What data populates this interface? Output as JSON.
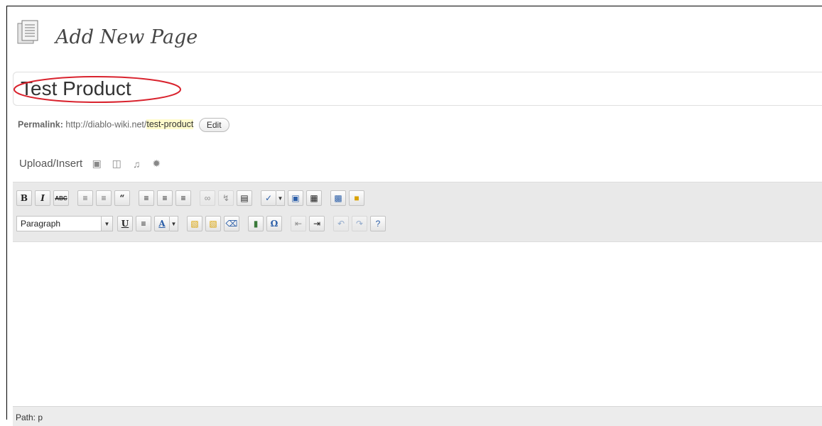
{
  "page": {
    "title": "Add New Page"
  },
  "post": {
    "title": "Test Product"
  },
  "permalink": {
    "label": "Permalink:",
    "base": "http://diablo-wiki.net/",
    "slug": "test-product",
    "edit_label": "Edit"
  },
  "media": {
    "label": "Upload/Insert",
    "icons": [
      "add-image-icon",
      "add-video-icon",
      "add-audio-icon",
      "add-media-icon"
    ]
  },
  "toolbar": {
    "row1_icons": [
      "bold-icon",
      "italic-icon",
      "strikethrough-icon",
      "bullet-list-icon",
      "numbered-list-icon",
      "blockquote-icon",
      "align-left-icon",
      "align-center-icon",
      "align-right-icon",
      "link-icon",
      "unlink-icon",
      "more-tag-icon",
      "spellcheck-icon",
      "fullscreen-icon",
      "kitchen-sink-icon",
      "insert-image-icon",
      "sticky-note-icon"
    ],
    "format_select": "Paragraph",
    "row2_icons": [
      "underline-icon",
      "justify-icon",
      "text-color-icon",
      "paste-text-icon",
      "paste-word-icon",
      "remove-format-icon",
      "insert-media-icon",
      "special-char-icon",
      "outdent-icon",
      "indent-icon",
      "undo-icon",
      "redo-icon",
      "help-icon"
    ]
  },
  "status": {
    "path": "Path: p"
  },
  "colors": {
    "title_ellipse": "#d9232e",
    "slug_highlight": "#fffbcc",
    "toolbar_bg": "#e9e9e9"
  }
}
